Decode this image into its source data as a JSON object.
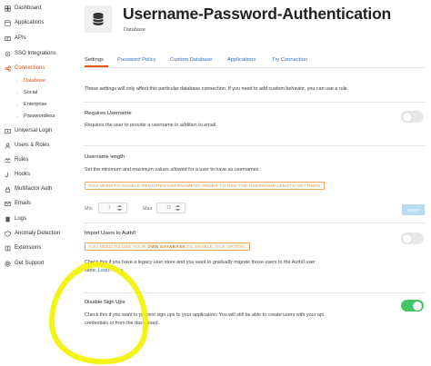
{
  "sidebar": {
    "items": [
      {
        "label": "Dashboard",
        "icon": "dashboard-icon"
      },
      {
        "label": "Applications",
        "icon": "applications-icon"
      },
      {
        "label": "APIs",
        "icon": "apis-icon"
      },
      {
        "label": "SSO Integrations",
        "icon": "sso-icon"
      },
      {
        "label": "Connections",
        "icon": "connections-icon",
        "active": true
      },
      {
        "label": "Universal Login",
        "icon": "universal-login-icon"
      },
      {
        "label": "Users & Roles",
        "icon": "users-icon"
      },
      {
        "label": "Rules",
        "icon": "rules-icon"
      },
      {
        "label": "Hooks",
        "icon": "hooks-icon"
      },
      {
        "label": "Multifactor Auth",
        "icon": "mfa-icon"
      },
      {
        "label": "Emails",
        "icon": "emails-icon"
      },
      {
        "label": "Logs",
        "icon": "logs-icon"
      },
      {
        "label": "Anomaly Detection",
        "icon": "anomaly-icon"
      },
      {
        "label": "Extensions",
        "icon": "extensions-icon"
      },
      {
        "label": "Get Support",
        "icon": "support-icon"
      }
    ],
    "subitems": [
      {
        "label": "Database",
        "active": true
      },
      {
        "label": "Social"
      },
      {
        "label": "Enterprise"
      },
      {
        "label": "Passwordless"
      }
    ]
  },
  "header": {
    "title": "Username-Password-Authentication",
    "subtitle": "Database",
    "icon": "database-icon"
  },
  "tabs": [
    "Settings",
    "Password Policy",
    "Custom Database",
    "Applications",
    "Try Connection"
  ],
  "intro": "These settings will only affect this particular database connection. If you need to add custom behavior, you can use a rule.",
  "requires_username": {
    "title": "Requires Username",
    "description": "Requires the user to provide a username in addition to email.",
    "enabled": false
  },
  "username_length": {
    "title": "Username length",
    "description": "Set the minimum and maximum values allowed for a user to have as usernames.",
    "warning": "YOU NEED TO ENABLE REQUIRES USERNAME IN ORDER TO USE THE USERNAME LENGTH SETTINGS",
    "min_label": "Min",
    "min_value": "1",
    "max_label": "Max",
    "max_value": "15",
    "save_label": "SAVE"
  },
  "import_users": {
    "title": "Import Users to Auth0",
    "warning_prefix": "YOU NEED TO USE YOUR ",
    "warning_strong": "OWN DATABASE",
    "warning_suffix": " TO ENABLE THIS OPTION.",
    "description_line1": "Check this if you have a legacy user store and you want to gradually migrate those users to the Auth0 user",
    "description_line2": "store.",
    "learn_more": "Learn More.",
    "enabled": false
  },
  "disable_signups": {
    "title": "Disable Sign Ups",
    "description_line1": "Check this if you want to prevent sign ups to your application. You will still be able to create users with your api",
    "description_line2": "credentials or from the dashboard.",
    "enabled": true
  },
  "colors": {
    "accent": "#e8530e",
    "link": "#2f6fc4",
    "toggle_on": "#44c767",
    "warning": "#f0a75d",
    "highlight": "#f2f20a"
  }
}
